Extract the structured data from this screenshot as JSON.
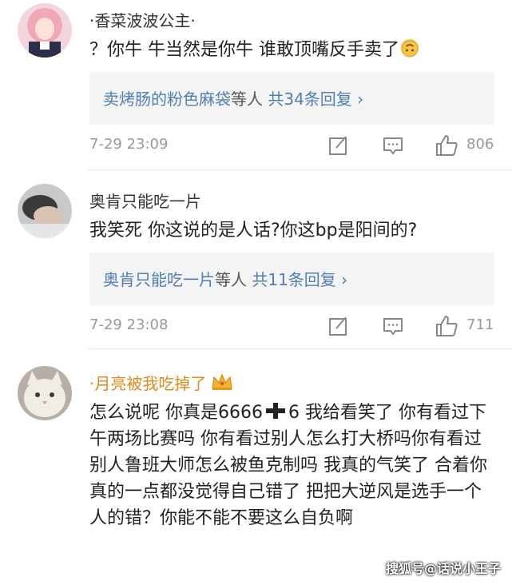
{
  "comments": [
    {
      "username": "·香菜波波公主·",
      "text": "？你牛 牛当然是你牛 谁敢顶嘴反手卖了",
      "reply_author": "卖烤肠的粉色麻袋",
      "reply_connector": "等人",
      "reply_count": "共34条回复 ",
      "reply_chevron": "›",
      "time": "7-29 23:09",
      "likes": "806"
    },
    {
      "username": "奥肯只能吃一片",
      "text": "我笑死 你这说的是人话?你这bp是阳间的?",
      "reply_author": "奥肯只能吃一片",
      "reply_connector": "等人",
      "reply_count": "共11条回复 ",
      "reply_chevron": "›",
      "time": "7-29 23:08",
      "likes": "711"
    },
    {
      "username": "·月亮被我吃掉了",
      "text_part1": "怎么说呢 你真是6666",
      "text_part2": "6 我给看笑了 你有看过下午两场比赛吗 你有看过别人怎么打大桥吗你有看过别人鲁班大师怎么被鱼克制吗 我真的气笑了 合着你真的一点都没觉得自己错了 把把大逆风是选手一个人的错？你能不能不要这么自负啊"
    }
  ],
  "watermark": "搜狐号@话说小王子",
  "colors": {
    "link": "#4e7fb3",
    "vip_name": "#e08a1b",
    "meta": "#999999",
    "reply_bg": "#f4f4f4"
  },
  "icons": [
    "edit-icon",
    "comment-icon",
    "thumb-up-icon",
    "crown-icon",
    "upside-down-face-emoji",
    "heavy-plus-emoji"
  ]
}
